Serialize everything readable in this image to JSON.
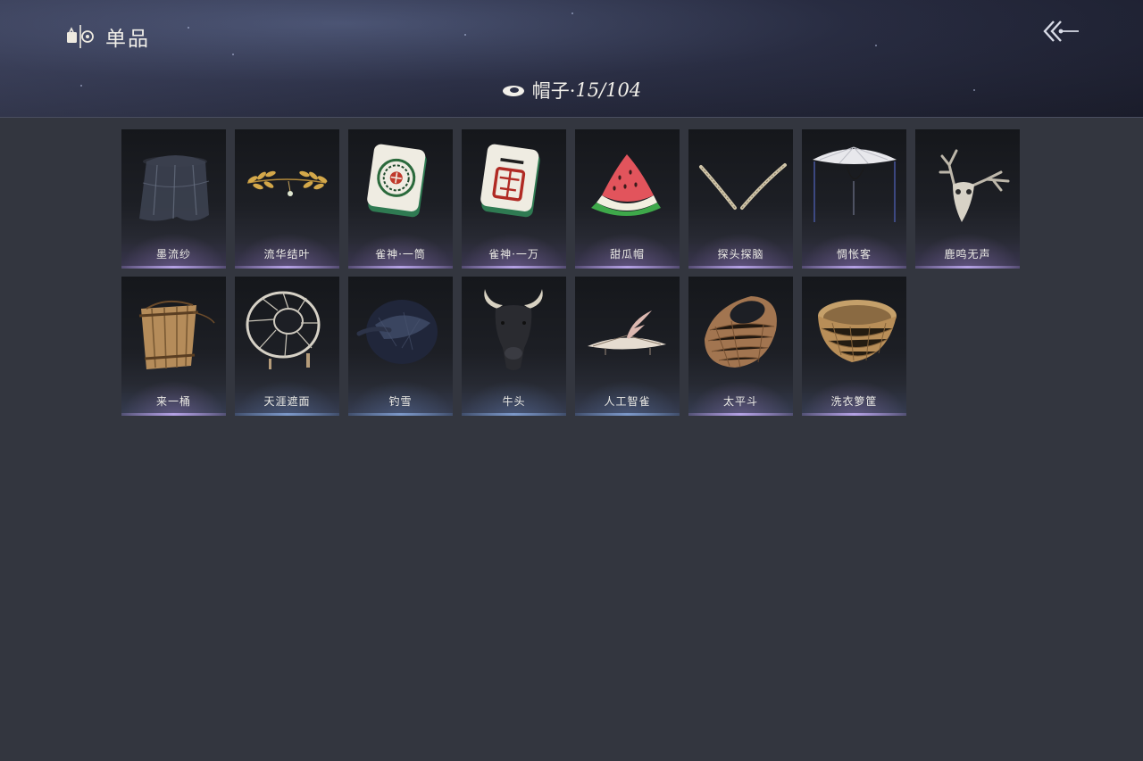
{
  "header": {
    "title": "单品",
    "category_label": "帽子·",
    "category_count": "15/104"
  },
  "items": [
    {
      "label": "墨流纱",
      "icon": "dark-veil-hat-icon"
    },
    {
      "label": "流华结叶",
      "icon": "golden-laurel-icon"
    },
    {
      "label": "雀神·一筒",
      "icon": "mahjong-tile-one-circle-icon"
    },
    {
      "label": "雀神·一万",
      "icon": "mahjong-tile-one-wan-icon"
    },
    {
      "label": "甜瓜帽",
      "icon": "watermelon-hat-icon"
    },
    {
      "label": "探头探脑",
      "icon": "feather-antennae-icon"
    },
    {
      "label": "惆怅客",
      "icon": "veiled-umbrella-hat-icon"
    },
    {
      "label": "鹿鸣无声",
      "icon": "deer-skull-icon"
    },
    {
      "label": "来一桶",
      "icon": "wooden-bucket-icon"
    },
    {
      "label": "天涯遮面",
      "icon": "bamboo-frame-hat-icon"
    },
    {
      "label": "钓雪",
      "icon": "dark-straw-hat-icon"
    },
    {
      "label": "牛头",
      "icon": "bull-head-icon"
    },
    {
      "label": "人工智雀",
      "icon": "bird-hat-icon"
    },
    {
      "label": "太平斗",
      "icon": "wicker-basket-hat-icon"
    },
    {
      "label": "洗衣箩筐",
      "icon": "laundry-basket-icon"
    }
  ]
}
